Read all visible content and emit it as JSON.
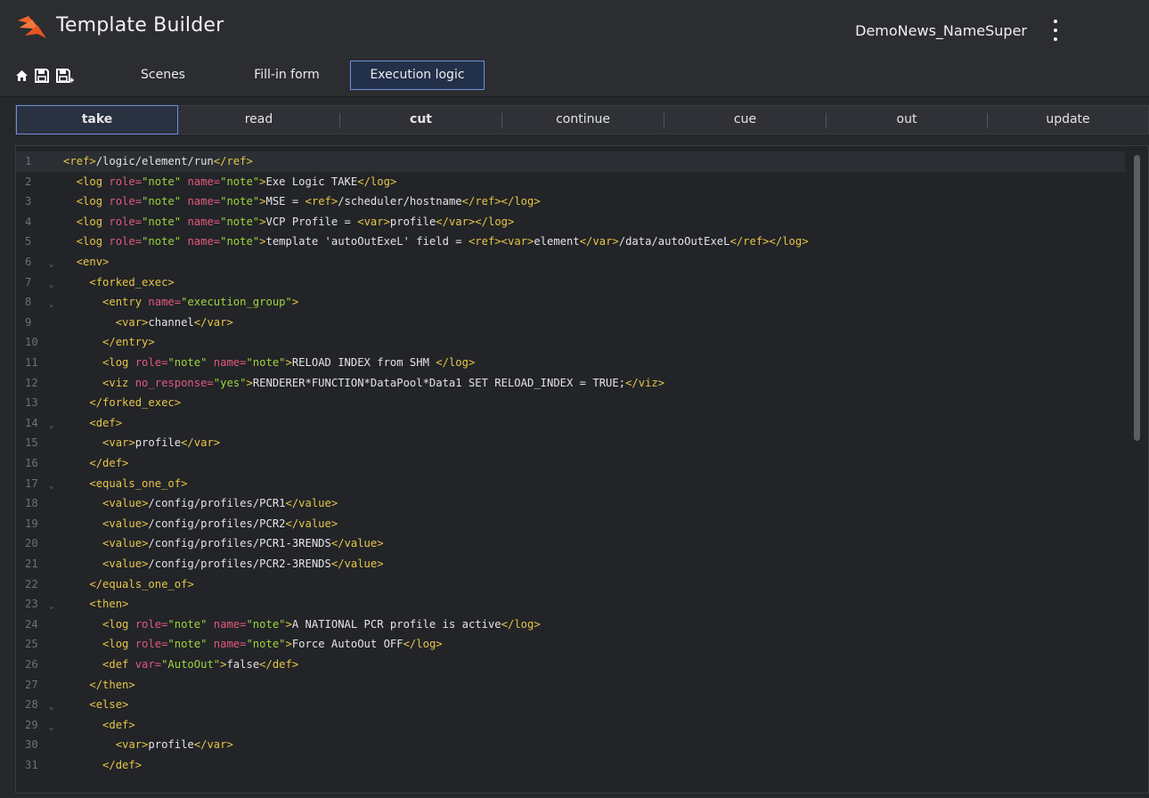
{
  "app": {
    "title": "Template Builder",
    "template_name": "DemoNews_NameSuper"
  },
  "toolbar": {
    "tabs": [
      {
        "label": "Scenes"
      },
      {
        "label": "Fill-in form"
      },
      {
        "label": "Execution logic"
      }
    ],
    "icons": [
      "home-icon",
      "save-icon",
      "save-as-icon"
    ]
  },
  "actions": [
    {
      "label": "take"
    },
    {
      "label": "read"
    },
    {
      "label": "cut"
    },
    {
      "label": "continue"
    },
    {
      "label": "cue"
    },
    {
      "label": "out"
    },
    {
      "label": "update"
    }
  ],
  "colors": {
    "accent": "#6e8fd8",
    "tag": "#e7c547",
    "attr": "#e2587c",
    "string": "#9fd43a",
    "logo": "#f0642d"
  },
  "code_lines": [
    {
      "n": "1",
      "fold": false,
      "i": 0,
      "seg": [
        [
          "t",
          "<ref>"
        ],
        [
          "x",
          "/logic/element/run"
        ],
        [
          "t",
          "</ref>"
        ]
      ]
    },
    {
      "n": "2",
      "fold": false,
      "i": 1,
      "seg": [
        [
          "t",
          "<log "
        ],
        [
          "a",
          "role="
        ],
        [
          "s",
          "\"note\""
        ],
        [
          "x",
          " "
        ],
        [
          "a",
          "name="
        ],
        [
          "s",
          "\"note\""
        ],
        [
          "t",
          ">"
        ],
        [
          "x",
          "Exe Logic TAKE"
        ],
        [
          "t",
          "</log>"
        ]
      ]
    },
    {
      "n": "3",
      "fold": false,
      "i": 1,
      "seg": [
        [
          "t",
          "<log "
        ],
        [
          "a",
          "role="
        ],
        [
          "s",
          "\"note\""
        ],
        [
          "x",
          " "
        ],
        [
          "a",
          "name="
        ],
        [
          "s",
          "\"note\""
        ],
        [
          "t",
          ">"
        ],
        [
          "x",
          "MSE = "
        ],
        [
          "t",
          "<ref>"
        ],
        [
          "x",
          "/scheduler/hostname"
        ],
        [
          "t",
          "</ref></log>"
        ]
      ]
    },
    {
      "n": "4",
      "fold": false,
      "i": 1,
      "seg": [
        [
          "t",
          "<log "
        ],
        [
          "a",
          "role="
        ],
        [
          "s",
          "\"note\""
        ],
        [
          "x",
          " "
        ],
        [
          "a",
          "name="
        ],
        [
          "s",
          "\"note\""
        ],
        [
          "t",
          ">"
        ],
        [
          "x",
          "VCP Profile = "
        ],
        [
          "t",
          "<var>"
        ],
        [
          "x",
          "profile"
        ],
        [
          "t",
          "</var></log>"
        ]
      ]
    },
    {
      "n": "5",
      "fold": false,
      "i": 1,
      "seg": [
        [
          "t",
          "<log "
        ],
        [
          "a",
          "role="
        ],
        [
          "s",
          "\"note\""
        ],
        [
          "x",
          " "
        ],
        [
          "a",
          "name="
        ],
        [
          "s",
          "\"note\""
        ],
        [
          "t",
          ">"
        ],
        [
          "x",
          "template 'autoOutExeL' field = "
        ],
        [
          "t",
          "<ref><var>"
        ],
        [
          "x",
          "element"
        ],
        [
          "t",
          "</var>"
        ],
        [
          "x",
          "/data/autoOutExeL"
        ],
        [
          "t",
          "</ref></log>"
        ]
      ]
    },
    {
      "n": "6",
      "fold": true,
      "i": 1,
      "seg": [
        [
          "t",
          "<env>"
        ]
      ]
    },
    {
      "n": "7",
      "fold": true,
      "i": 2,
      "seg": [
        [
          "t",
          "<forked_exec>"
        ]
      ]
    },
    {
      "n": "8",
      "fold": true,
      "i": 3,
      "seg": [
        [
          "t",
          "<entry "
        ],
        [
          "a",
          "name="
        ],
        [
          "s",
          "\"execution_group\""
        ],
        [
          "t",
          ">"
        ]
      ]
    },
    {
      "n": "9",
      "fold": false,
      "i": 4,
      "seg": [
        [
          "t",
          "<var>"
        ],
        [
          "x",
          "channel"
        ],
        [
          "t",
          "</var>"
        ]
      ]
    },
    {
      "n": "10",
      "fold": false,
      "i": 3,
      "seg": [
        [
          "t",
          "</entry>"
        ]
      ]
    },
    {
      "n": "11",
      "fold": false,
      "i": 3,
      "seg": [
        [
          "t",
          "<log "
        ],
        [
          "a",
          "role="
        ],
        [
          "s",
          "\"note\""
        ],
        [
          "x",
          " "
        ],
        [
          "a",
          "name="
        ],
        [
          "s",
          "\"note\""
        ],
        [
          "t",
          ">"
        ],
        [
          "x",
          "RELOAD INDEX from SHM "
        ],
        [
          "t",
          "</log>"
        ]
      ]
    },
    {
      "n": "12",
      "fold": false,
      "i": 3,
      "seg": [
        [
          "t",
          "<viz "
        ],
        [
          "a",
          "no_response="
        ],
        [
          "s",
          "\"yes\""
        ],
        [
          "t",
          ">"
        ],
        [
          "x",
          "RENDERER*FUNCTION*DataPool*Data1 SET RELOAD_INDEX = TRUE;"
        ],
        [
          "t",
          "</viz>"
        ]
      ]
    },
    {
      "n": "13",
      "fold": false,
      "i": 2,
      "seg": [
        [
          "t",
          "</forked_exec>"
        ]
      ]
    },
    {
      "n": "14",
      "fold": true,
      "i": 2,
      "seg": [
        [
          "t",
          "<def>"
        ]
      ]
    },
    {
      "n": "15",
      "fold": false,
      "i": 3,
      "seg": [
        [
          "t",
          "<var>"
        ],
        [
          "x",
          "profile"
        ],
        [
          "t",
          "</var>"
        ]
      ]
    },
    {
      "n": "16",
      "fold": false,
      "i": 2,
      "seg": [
        [
          "t",
          "</def>"
        ]
      ]
    },
    {
      "n": "17",
      "fold": true,
      "i": 2,
      "seg": [
        [
          "t",
          "<equals_one_of>"
        ]
      ]
    },
    {
      "n": "18",
      "fold": false,
      "i": 3,
      "seg": [
        [
          "t",
          "<value>"
        ],
        [
          "x",
          "/config/profiles/PCR1"
        ],
        [
          "t",
          "</value>"
        ]
      ]
    },
    {
      "n": "19",
      "fold": false,
      "i": 3,
      "seg": [
        [
          "t",
          "<value>"
        ],
        [
          "x",
          "/config/profiles/PCR2"
        ],
        [
          "t",
          "</value>"
        ]
      ]
    },
    {
      "n": "20",
      "fold": false,
      "i": 3,
      "seg": [
        [
          "t",
          "<value>"
        ],
        [
          "x",
          "/config/profiles/PCR1-3RENDS"
        ],
        [
          "t",
          "</value>"
        ]
      ]
    },
    {
      "n": "21",
      "fold": false,
      "i": 3,
      "seg": [
        [
          "t",
          "<value>"
        ],
        [
          "x",
          "/config/profiles/PCR2-3RENDS"
        ],
        [
          "t",
          "</value>"
        ]
      ]
    },
    {
      "n": "22",
      "fold": false,
      "i": 2,
      "seg": [
        [
          "t",
          "</equals_one_of>"
        ]
      ]
    },
    {
      "n": "23",
      "fold": true,
      "i": 2,
      "seg": [
        [
          "t",
          "<then>"
        ]
      ]
    },
    {
      "n": "24",
      "fold": false,
      "i": 3,
      "seg": [
        [
          "t",
          "<log "
        ],
        [
          "a",
          "role="
        ],
        [
          "s",
          "\"note\""
        ],
        [
          "x",
          " "
        ],
        [
          "a",
          "name="
        ],
        [
          "s",
          "\"note\""
        ],
        [
          "t",
          ">"
        ],
        [
          "x",
          "A NATIONAL PCR profile is active"
        ],
        [
          "t",
          "</log>"
        ]
      ]
    },
    {
      "n": "25",
      "fold": false,
      "i": 3,
      "seg": [
        [
          "t",
          "<log "
        ],
        [
          "a",
          "role="
        ],
        [
          "s",
          "\"note\""
        ],
        [
          "x",
          " "
        ],
        [
          "a",
          "name="
        ],
        [
          "s",
          "\"note\""
        ],
        [
          "t",
          ">"
        ],
        [
          "x",
          "Force AutoOut OFF"
        ],
        [
          "t",
          "</log>"
        ]
      ]
    },
    {
      "n": "26",
      "fold": false,
      "i": 3,
      "seg": [
        [
          "t",
          "<def "
        ],
        [
          "a",
          "var="
        ],
        [
          "s",
          "\"AutoOut\""
        ],
        [
          "t",
          ">"
        ],
        [
          "x",
          "false"
        ],
        [
          "t",
          "</def>"
        ]
      ]
    },
    {
      "n": "27",
      "fold": false,
      "i": 2,
      "seg": [
        [
          "t",
          "</then>"
        ]
      ]
    },
    {
      "n": "28",
      "fold": true,
      "i": 2,
      "seg": [
        [
          "t",
          "<else>"
        ]
      ]
    },
    {
      "n": "29",
      "fold": true,
      "i": 3,
      "seg": [
        [
          "t",
          "<def>"
        ]
      ]
    },
    {
      "n": "30",
      "fold": false,
      "i": 4,
      "seg": [
        [
          "t",
          "<var>"
        ],
        [
          "x",
          "profile"
        ],
        [
          "t",
          "</var>"
        ]
      ]
    },
    {
      "n": "31",
      "fold": false,
      "i": 3,
      "seg": [
        [
          "t",
          "</def>"
        ]
      ]
    }
  ]
}
